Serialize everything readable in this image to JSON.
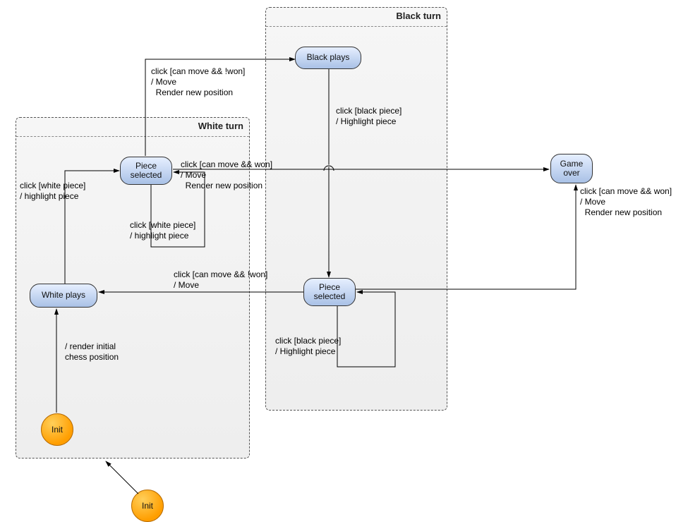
{
  "regions": {
    "white": {
      "title": "White turn"
    },
    "black": {
      "title": "Black turn"
    }
  },
  "states": {
    "white_plays": "White plays",
    "white_piece_sel": "Piece\nselected",
    "black_plays": "Black plays",
    "black_piece_sel": "Piece\nselected",
    "game_over": "Game\nover",
    "init": "Init"
  },
  "transitions": {
    "init_white": "/ render initial\nchess position",
    "white_to_sel": "click [white piece]\n/ highlight piece",
    "white_sel_self": "click [white piece]\n/ highlight piece",
    "white_sel_to_black": "click [can move && !won]\n/ Move\n  Render new position",
    "white_sel_to_over": "click [can move && won]\n/ Move\n  Render new position",
    "black_to_sel": "click [black piece]\n/ Highlight piece",
    "black_sel_self": "click [black piece]\n/ Highlight piece",
    "black_sel_to_white": "click [can move && !won]\n/ Move",
    "black_sel_to_over": "click [can move && won]\n/ Move\n  Render new position"
  }
}
